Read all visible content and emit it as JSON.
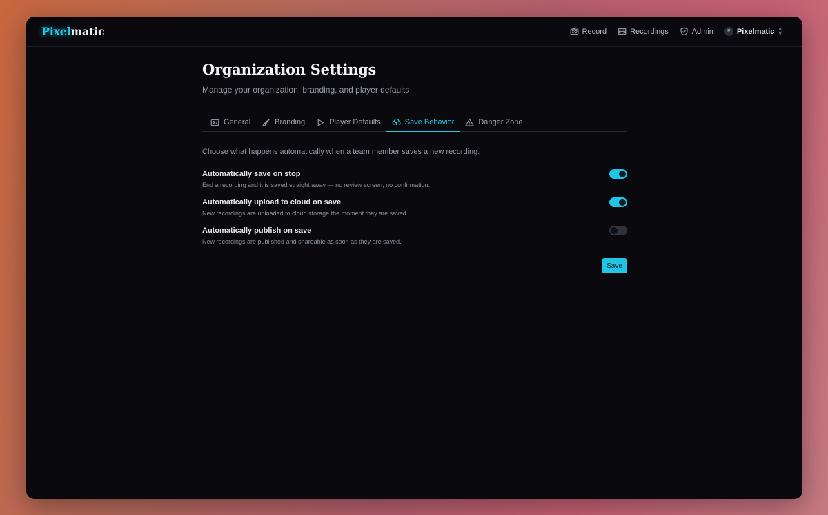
{
  "brand": {
    "part1": "Pixel",
    "part2": "matic"
  },
  "nav": {
    "record": "Record",
    "recordings": "Recordings",
    "admin": "Admin",
    "org_initial": "P",
    "org_name": "Pixelmatic"
  },
  "page": {
    "title": "Organization Settings",
    "subtitle": "Manage your organization, branding, and player defaults"
  },
  "tabs": [
    {
      "label": "General",
      "icon": "id-card-icon"
    },
    {
      "label": "Branding",
      "icon": "paintbrush-icon"
    },
    {
      "label": "Player Defaults",
      "icon": "play-icon"
    },
    {
      "label": "Save Behavior",
      "icon": "cloud-upload-icon",
      "active": true
    },
    {
      "label": "Danger Zone",
      "icon": "warning-icon"
    }
  ],
  "description": "Choose what happens automatically when a team member saves a new recording.",
  "settings": [
    {
      "label": "Automatically save on stop",
      "help": "End a recording and it is saved straight away — no review screen, no confirmation.",
      "enabled": true
    },
    {
      "label": "Automatically upload to cloud on save",
      "help": "New recordings are uploaded to cloud storage the moment they are saved.",
      "enabled": true
    },
    {
      "label": "Automatically publish on save",
      "help": "New recordings are published and shareable as soon as they are saved.",
      "enabled": false
    }
  ],
  "save_label": "Save",
  "colors": {
    "accent": "#22c7e6",
    "background": "#0a0a0e"
  }
}
